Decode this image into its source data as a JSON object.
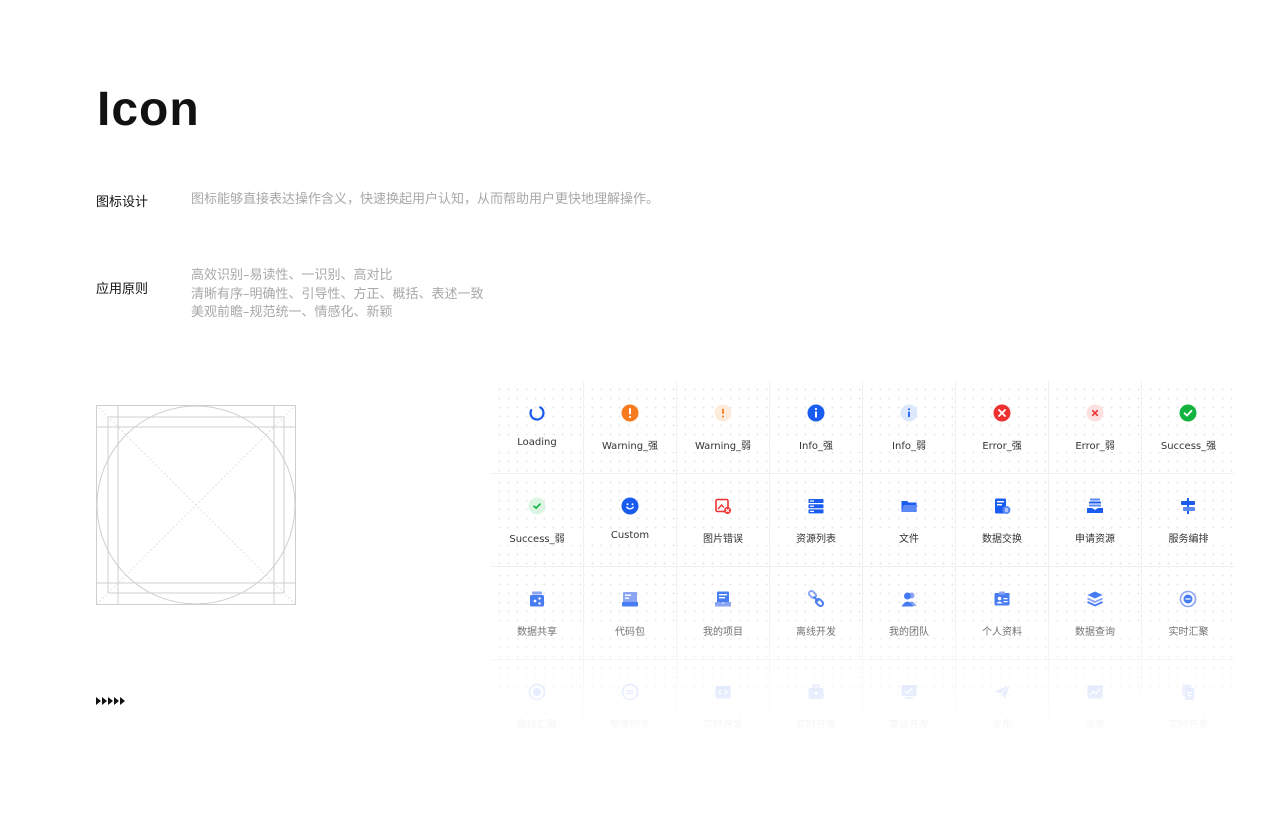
{
  "title": "Icon",
  "sections": [
    {
      "label": "图标设计",
      "lines": [
        "图标能够直接表达操作含义，快速换起用户认知，从而帮助用户更快地理解操作。"
      ]
    },
    {
      "label": "应用原则",
      "lines": [
        "高效识别–易读性、一识别、高对比",
        "清晰有序–明确性、引导性、方正、概括、表述一致",
        "美观前瞻–规范统一、情感化、新颖"
      ]
    }
  ],
  "colors": {
    "blue": "#1a5cf0",
    "orange": "#f77a1e",
    "red": "#ef3131",
    "green": "#12b33e",
    "muted_blue": "#6f8ff0"
  },
  "icons": [
    {
      "label": "Loading",
      "icon": "loading-icon"
    },
    {
      "label": "Warning_强",
      "icon": "warning-strong-icon"
    },
    {
      "label": "Warning_弱",
      "icon": "warning-weak-icon"
    },
    {
      "label": "Info_强",
      "icon": "info-strong-icon"
    },
    {
      "label": "Info_弱",
      "icon": "info-weak-icon"
    },
    {
      "label": "Error_强",
      "icon": "error-strong-icon"
    },
    {
      "label": "Error_弱",
      "icon": "error-weak-icon"
    },
    {
      "label": "Success_强",
      "icon": "success-strong-icon"
    },
    {
      "label": "Success_弱",
      "icon": "success-weak-icon"
    },
    {
      "label": "Custom",
      "icon": "custom-smile-icon"
    },
    {
      "label": "图片错误",
      "icon": "image-error-icon"
    },
    {
      "label": "资源列表",
      "icon": "resource-list-icon"
    },
    {
      "label": "文件",
      "icon": "folder-icon"
    },
    {
      "label": "数据交换",
      "icon": "data-exchange-icon"
    },
    {
      "label": "申请资源",
      "icon": "apply-resource-icon"
    },
    {
      "label": "服务编排",
      "icon": "service-orchestration-icon"
    },
    {
      "label": "数据共享",
      "icon": "data-share-icon"
    },
    {
      "label": "代码包",
      "icon": "code-package-icon"
    },
    {
      "label": "我的项目",
      "icon": "my-project-icon"
    },
    {
      "label": "离线开发",
      "icon": "offline-dev-icon"
    },
    {
      "label": "我的团队",
      "icon": "my-team-icon"
    },
    {
      "label": "个人资料",
      "icon": "profile-icon"
    },
    {
      "label": "数据查询",
      "icon": "data-query-icon"
    },
    {
      "label": "实时汇聚",
      "icon": "realtime-gather-icon"
    },
    {
      "label": "离线汇聚",
      "icon": "offline-gather-icon"
    },
    {
      "label": "整库同步",
      "icon": "db-sync-icon"
    },
    {
      "label": "实时开发",
      "icon": "realtime-dev-icon"
    },
    {
      "label": "实时开发",
      "icon": "realtime-dev-toolbox-icon"
    },
    {
      "label": "算法开发",
      "icon": "algorithm-dev-icon"
    },
    {
      "label": "发布",
      "icon": "publish-icon"
    },
    {
      "label": "业务",
      "icon": "business-chart-icon"
    },
    {
      "label": "实时开发",
      "icon": "realtime-dev-doc-icon"
    }
  ]
}
